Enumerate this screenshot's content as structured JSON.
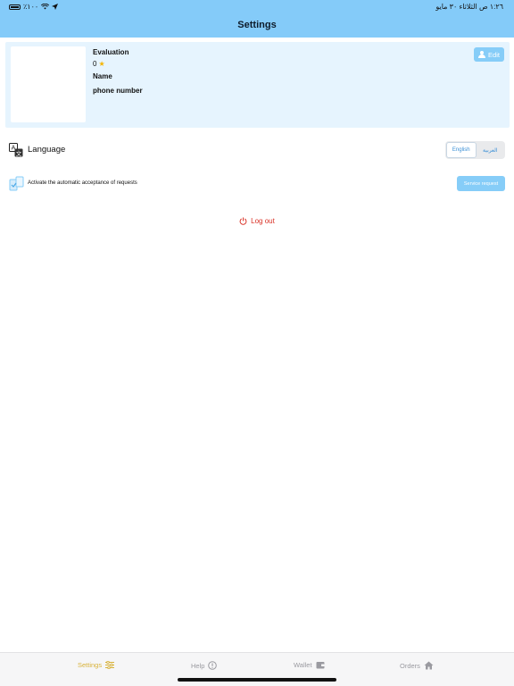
{
  "status_bar": {
    "battery": "٪١٠٠",
    "datetime": "١:٢٦ ص   الثلاثاء ٣٠ مايو"
  },
  "header": {
    "title": "Settings"
  },
  "profile": {
    "evaluation_label": "Evaluation",
    "rating": "0",
    "name_label": "Name",
    "phone_label": "phone number",
    "edit_label": "Edit"
  },
  "language": {
    "label": "Language",
    "options": [
      "English",
      "العربية"
    ],
    "selected": "English"
  },
  "auto_accept": {
    "label": "Activate the automatic acceptance of requests",
    "button_label": "Service request"
  },
  "logout_label": "Log out",
  "tabbar": {
    "settings": "Settings",
    "help": "Help",
    "wallet": "Wallet",
    "orders": "Orders"
  },
  "colors": {
    "header_bg": "#84cbf9",
    "card_bg": "#e6f4fe",
    "accent_button": "#86cdf8",
    "logout": "#d93025",
    "tab_active": "#d8b23a",
    "tab_inactive": "#9a9aa0"
  }
}
